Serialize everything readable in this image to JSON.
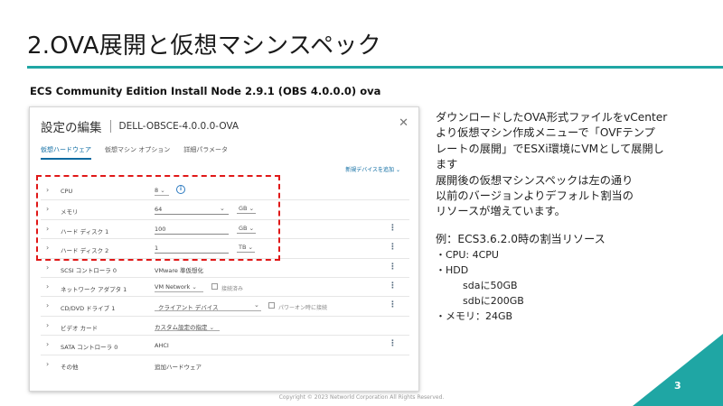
{
  "slide": {
    "title": "2.OVA展開と仮想マシンスペック",
    "subtitle": "ECS Community Edition Install Node 2.9.1 (OBS 4.0.0.0) ova",
    "copyright": "Copyright © 2023 Networld Corporation All Rights Reserved.",
    "page_number": "3",
    "accent_color": "#1fa6a4"
  },
  "dialog": {
    "title": "設定の編集",
    "vm_name": "DELL-OBSCE-4.0.0.0-OVA",
    "close_icon": "close-icon",
    "tabs": [
      {
        "label": "仮想ハードウェア",
        "active": true
      },
      {
        "label": "仮想マシン オプション",
        "active": false
      },
      {
        "label": "詳細パラメータ",
        "active": false
      }
    ],
    "add_device_label": "新規デバイスを追加 ⌄",
    "rows": {
      "cpu": {
        "label": "CPU",
        "value": "8"
      },
      "memory": {
        "label": "メモリ",
        "value": "64",
        "unit": "GB"
      },
      "hdd1": {
        "label": "ハード ディスク 1",
        "value": "100",
        "unit": "GB"
      },
      "hdd2": {
        "label": "ハード ディスク 2",
        "value": "1",
        "unit": "TB"
      },
      "scsi": {
        "label": "SCSI コントローラ 0",
        "value": "VMware 準仮想化"
      },
      "net": {
        "label": "ネットワーク アダプタ 1",
        "value": "VM Network",
        "check_label": "接続済み"
      },
      "cdrom": {
        "label": "CD/DVD ドライブ 1",
        "value": "クライアント デバイス",
        "check_label": "パワーオン時に接続"
      },
      "video": {
        "label": "ビデオ カード",
        "value": "カスタム設定の指定"
      },
      "sata": {
        "label": "SATA コントローラ 0",
        "value": "AHCI"
      },
      "other": {
        "label": "その他",
        "value": "追加ハードウェア"
      }
    }
  },
  "notes": {
    "lines_a": [
      "ダウンロードしたOVA形式ファイルをvCenter",
      "より仮想マシン作成メニューで「OVFテンプ",
      "レートの展開」でESXi環境にVMとして展開し",
      "ます"
    ],
    "lines_b": [
      "展開後の仮想マシンスペックは左の通り",
      "以前のバージョンよりデフォルト割当の",
      "リソースが増えています。"
    ],
    "example_heading": "例：ECS3.6.2.0時の割当リソース",
    "cpu_line": "・CPU: 4CPU",
    "hdd_line": "・HDD",
    "sda_line": "sdaに50GB",
    "sdb_line": "sdbに200GB",
    "mem_line": "・メモリ：24GB"
  }
}
